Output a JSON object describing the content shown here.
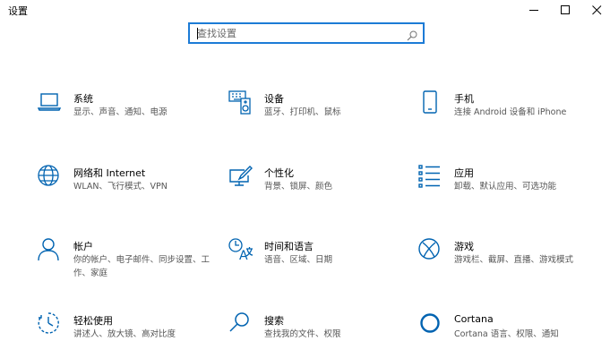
{
  "window": {
    "title": "设置"
  },
  "search": {
    "placeholder": "查找设置"
  },
  "tiles": [
    {
      "title": "系统",
      "desc": "显示、声音、通知、电源",
      "icon": "laptop-icon"
    },
    {
      "title": "设备",
      "desc": "蓝牙、打印机、鼠标",
      "icon": "keyboard-speaker-icon"
    },
    {
      "title": "手机",
      "desc": "连接 Android 设备和 iPhone",
      "icon": "phone-icon"
    },
    {
      "title": "网络和 Internet",
      "desc": "WLAN、飞行模式、VPN",
      "icon": "globe-icon"
    },
    {
      "title": "个性化",
      "desc": "背景、锁屏、颜色",
      "icon": "paintbrush-monitor-icon"
    },
    {
      "title": "应用",
      "desc": "卸载、默认应用、可选功能",
      "icon": "app-list-icon"
    },
    {
      "title": "帐户",
      "desc": "你的帐户、电子邮件、同步设置、工作、家庭",
      "icon": "person-icon"
    },
    {
      "title": "时间和语言",
      "desc": "语音、区域、日期",
      "icon": "time-language-icon"
    },
    {
      "title": "游戏",
      "desc": "游戏栏、截屏、直播、游戏模式",
      "icon": "xbox-icon"
    },
    {
      "title": "轻松使用",
      "desc": "讲述人、放大镜、高对比度",
      "icon": "ease-of-access-icon"
    },
    {
      "title": "搜索",
      "desc": "查找我的文件、权限",
      "icon": "magnifier-icon"
    },
    {
      "title": "Cortana",
      "desc": "Cortana 语言、权限、通知",
      "icon": "cortana-icon"
    }
  ],
  "colors": {
    "accent": "#1c7bd6",
    "icon": "#0063b1"
  }
}
